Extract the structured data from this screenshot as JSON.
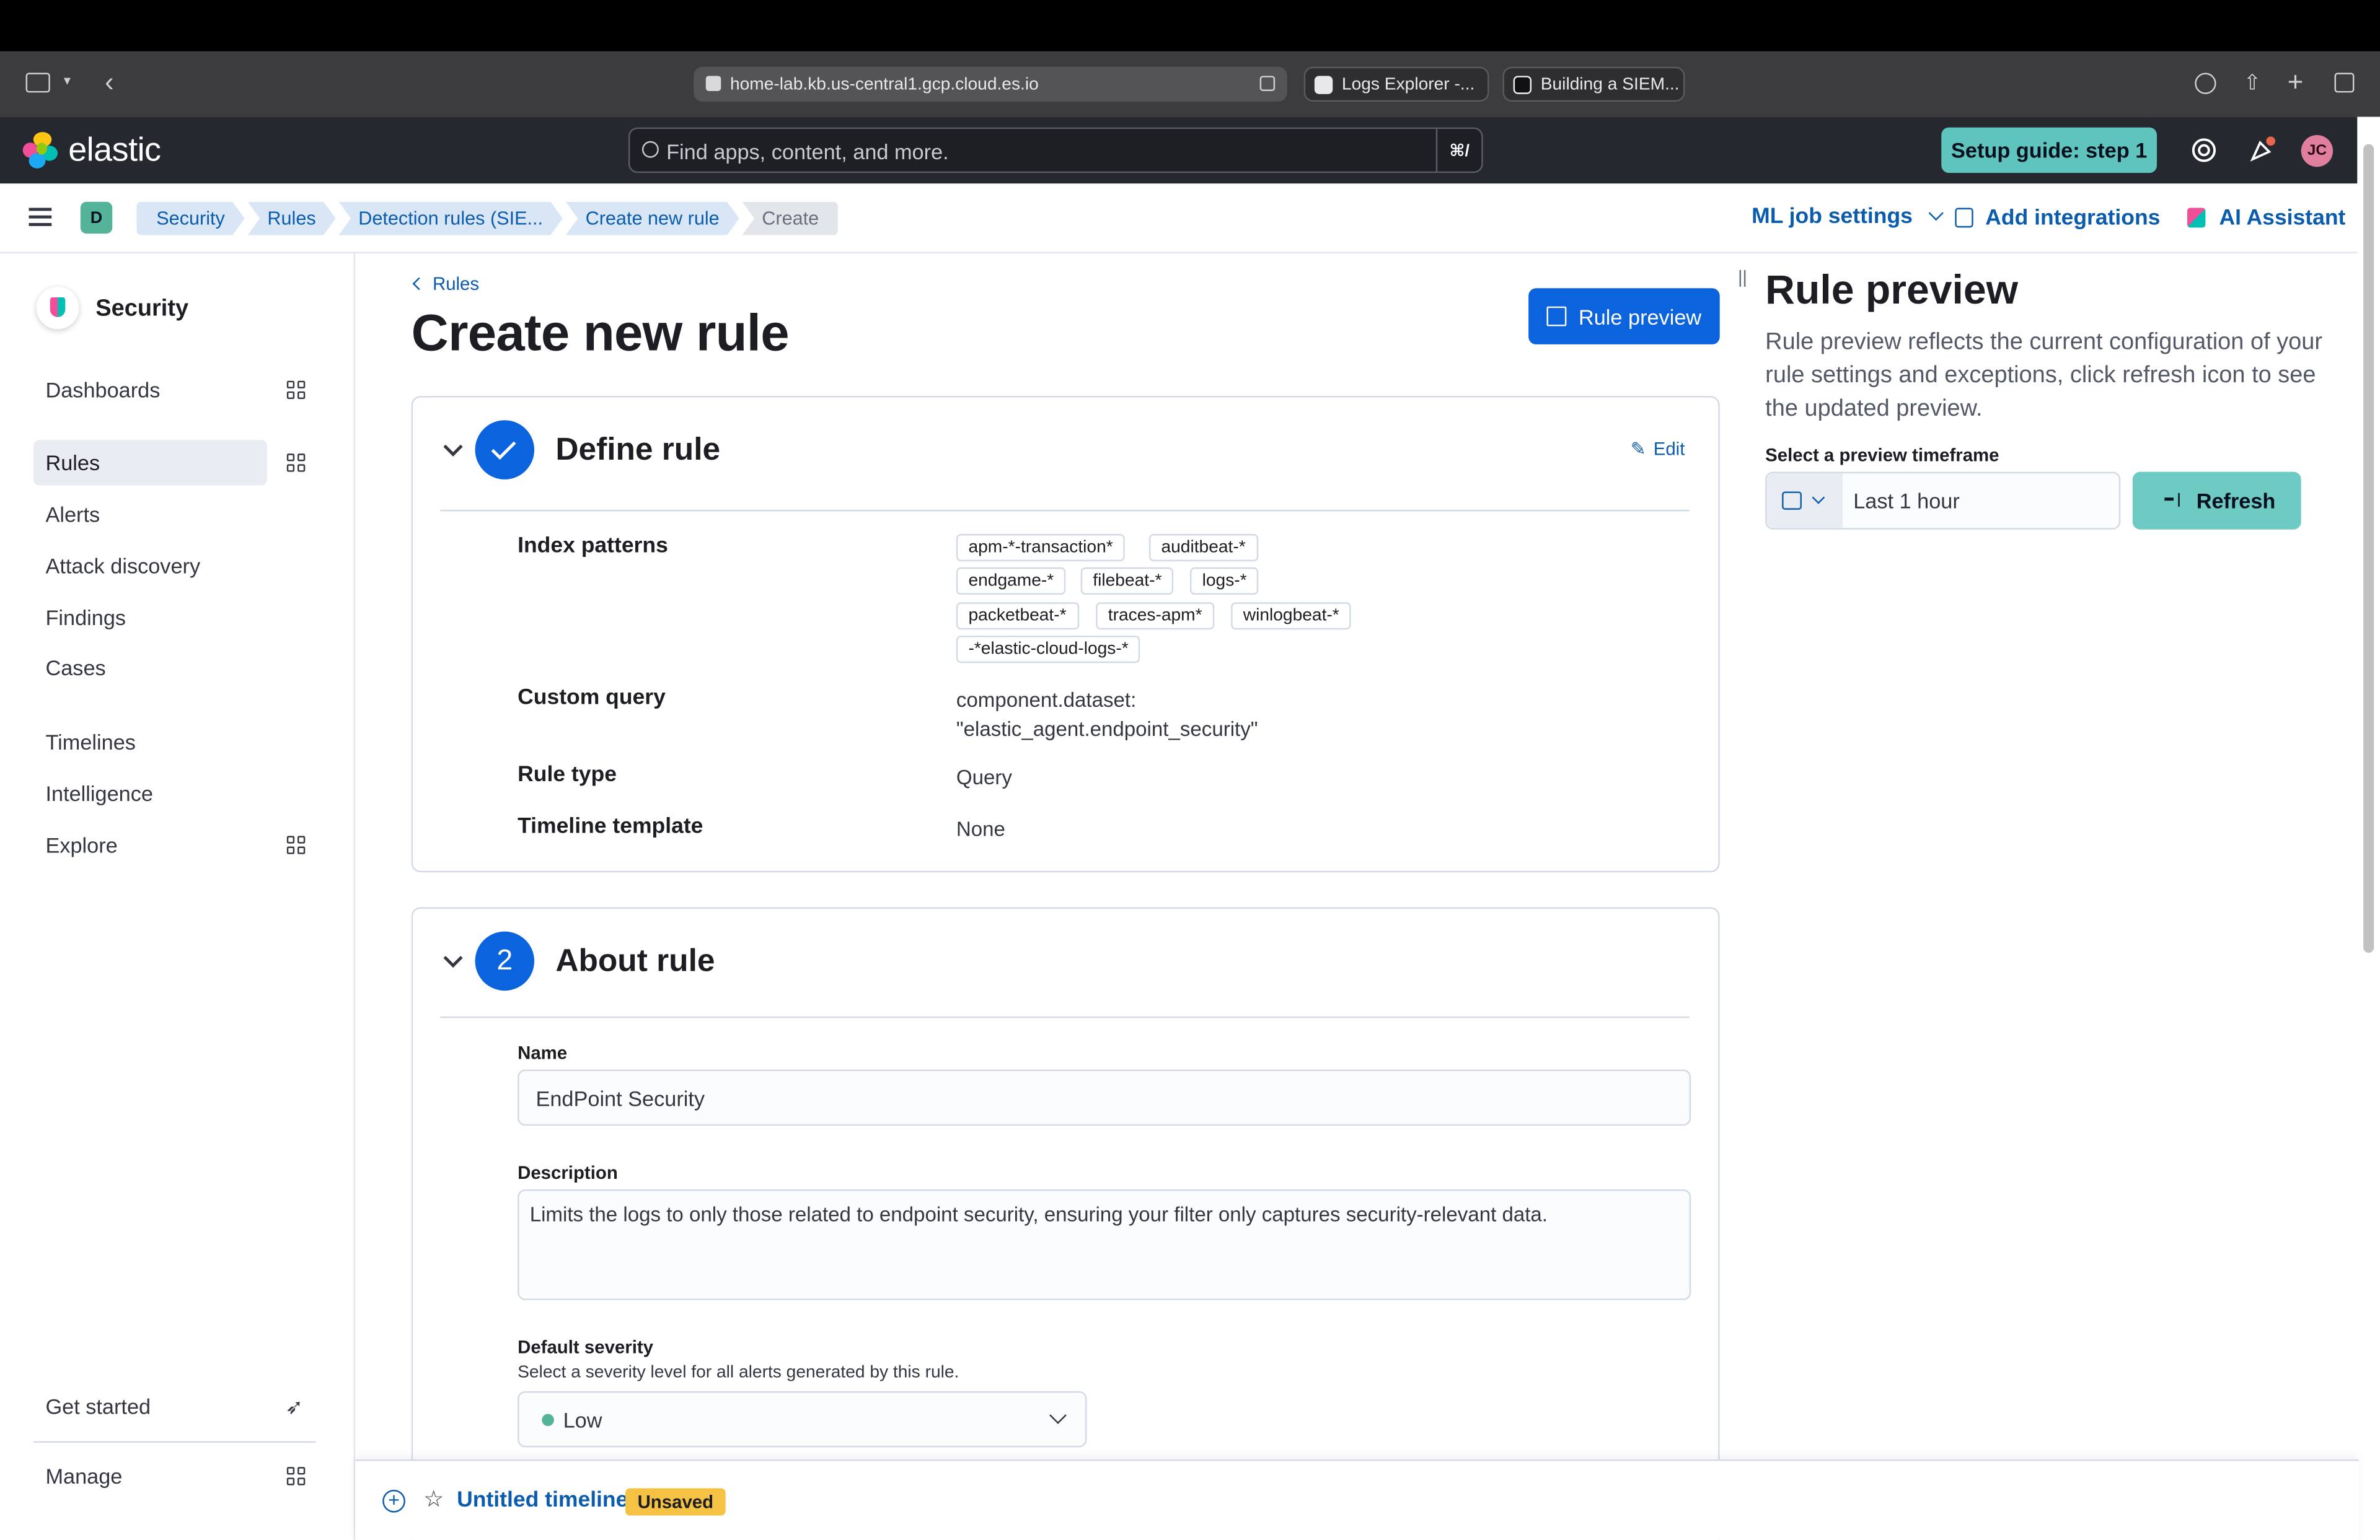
{
  "browser": {
    "url": "home-lab.kb.us-central1.gcp.cloud.es.io",
    "tabs": [
      "Logs Explorer -...",
      "Building a SIEM..."
    ]
  },
  "header": {
    "logo_text": "elastic",
    "search_placeholder": "Find apps, content, and more.",
    "search_shortcut": "⌘/",
    "setup_button": "Setup guide: step 1",
    "avatar_initials": "JC"
  },
  "breadcrumbs": {
    "space": "D",
    "items": [
      "Security",
      "Rules",
      "Detection rules (SIE...",
      "Create new rule",
      "Create"
    ],
    "ml_job_settings": "ML job settings",
    "add_integrations": "Add integrations",
    "ai_assistant": "AI Assistant"
  },
  "sidebar": {
    "title": "Security",
    "items": {
      "dashboards": "Dashboards",
      "rules": "Rules",
      "alerts": "Alerts",
      "attack_discovery": "Attack discovery",
      "findings": "Findings",
      "cases": "Cases",
      "timelines": "Timelines",
      "intelligence": "Intelligence",
      "explore": "Explore",
      "get_started": "Get started",
      "manage": "Manage"
    }
  },
  "main": {
    "back_link": "Rules",
    "title": "Create new rule",
    "rule_preview_button": "Rule preview",
    "define_rule": {
      "title": "Define rule",
      "edit": "Edit",
      "index_patterns_label": "Index patterns",
      "index_patterns": [
        "apm-*-transaction*",
        "auditbeat-*",
        "endgame-*",
        "filebeat-*",
        "logs-*",
        "packetbeat-*",
        "traces-apm*",
        "winlogbeat-*",
        "-*elastic-cloud-logs-*"
      ],
      "custom_query_label": "Custom query",
      "custom_query_line1": "component.dataset:",
      "custom_query_line2": "\"elastic_agent.endpoint_security\"",
      "rule_type_label": "Rule type",
      "rule_type": "Query",
      "timeline_template_label": "Timeline template",
      "timeline_template": "None"
    },
    "about_rule": {
      "step": "2",
      "title": "About rule",
      "name_label": "Name",
      "name_value": "EndPoint Security",
      "description_label": "Description",
      "description_value": "Limits the logs to only those related to endpoint security, ensuring your filter only captures security-relevant data.",
      "severity_label": "Default severity",
      "severity_help": "Select a severity level for all alerts generated by this rule.",
      "severity_value": "Low"
    }
  },
  "preview_panel": {
    "title": "Rule preview",
    "description": "Rule preview reflects the current configuration of your rule settings and exceptions, click refresh icon to see the updated preview.",
    "timeframe_label": "Select a preview timeframe",
    "timeframe_value": "Last 1 hour",
    "refresh_button": "Refresh"
  },
  "timeline_bar": {
    "name": "Untitled timeline",
    "badge": "Unsaved"
  },
  "colors": {
    "primary": "#0b64dd",
    "accent_teal": "#5fc4bd",
    "header_bg": "#25282f",
    "unsaved_badge": "#f6c244"
  }
}
